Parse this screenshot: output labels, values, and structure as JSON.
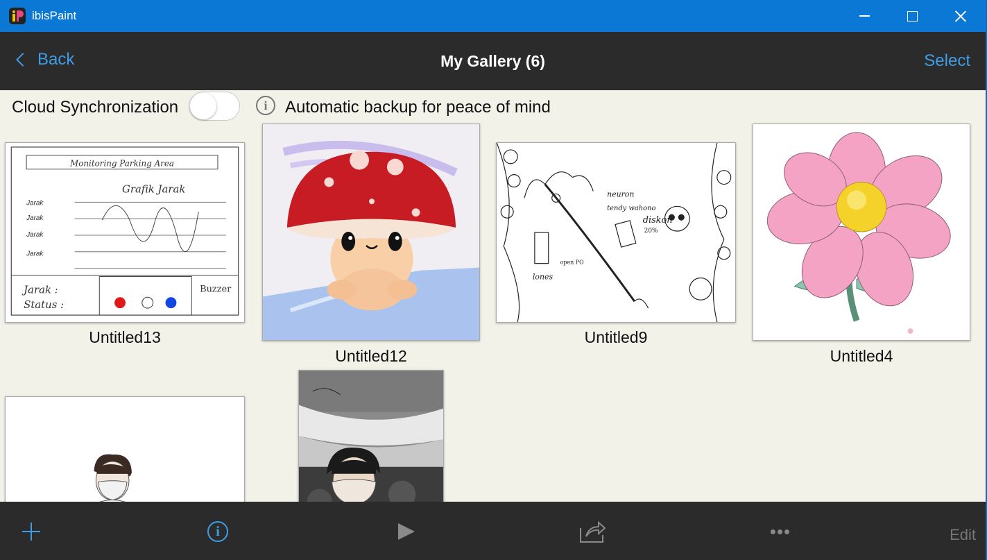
{
  "window": {
    "title": "ibisPaint"
  },
  "nav": {
    "back_label": "Back",
    "title": "My Gallery (6)",
    "select_label": "Select"
  },
  "cloud": {
    "label": "Cloud Synchronization",
    "toggle_on": false,
    "backup_text": "Automatic backup for peace of mind"
  },
  "artworks": [
    {
      "title": "Untitled13"
    },
    {
      "title": "Untitled12"
    },
    {
      "title": "Untitled9"
    },
    {
      "title": "Untitled4"
    },
    {
      "title": ""
    },
    {
      "title": ""
    }
  ],
  "thumb13": {
    "heading": "Monitoring Parking Area",
    "graph_label": "Grafik Jarak",
    "row_labels": [
      "Jarak",
      "Jarak",
      "Jarak",
      "Jarak"
    ],
    "jarak": "Jarak :",
    "status": "Status :",
    "buzzer": "Buzzer"
  },
  "thumb9": {
    "text1": "neuron",
    "text2": "tendy wahono",
    "text3": "diskon",
    "text4": "20%",
    "text5": "lones",
    "text6": "open PO"
  },
  "toolbar": {
    "edit_label": "Edit",
    "more_label": "•••"
  },
  "colors": {
    "accent": "#3d9ee8",
    "titlebar": "#0a78d4",
    "navbar": "#2b2b2b",
    "background": "#f3f2e9"
  }
}
